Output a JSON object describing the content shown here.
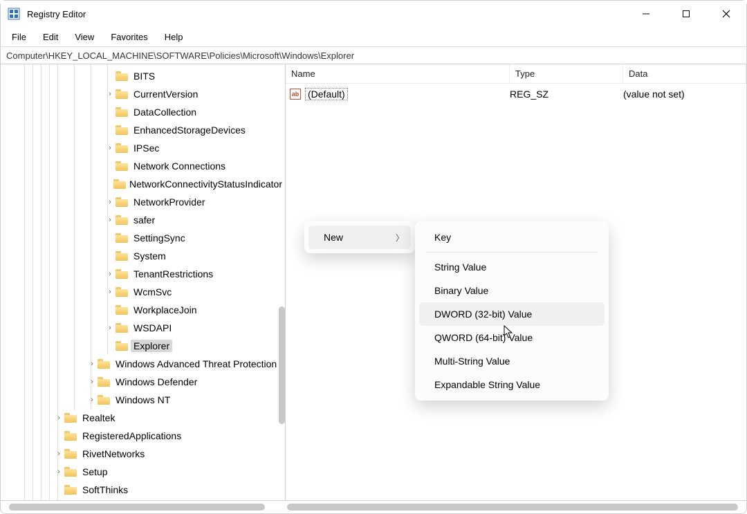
{
  "window": {
    "title": "Registry Editor"
  },
  "menu": {
    "items": [
      "File",
      "Edit",
      "View",
      "Favorites",
      "Help"
    ]
  },
  "address": {
    "path": "Computer\\HKEY_LOCAL_MACHINE\\SOFTWARE\\Policies\\Microsoft\\Windows\\Explorer"
  },
  "tree": {
    "items": [
      {
        "label": "BITS",
        "indent": 150,
        "expander": ""
      },
      {
        "label": "CurrentVersion",
        "indent": 150,
        "expander": "›"
      },
      {
        "label": "DataCollection",
        "indent": 150,
        "expander": ""
      },
      {
        "label": "EnhancedStorageDevices",
        "indent": 150,
        "expander": ""
      },
      {
        "label": "IPSec",
        "indent": 150,
        "expander": "›"
      },
      {
        "label": "Network Connections",
        "indent": 150,
        "expander": ""
      },
      {
        "label": "NetworkConnectivityStatusIndicator",
        "indent": 150,
        "expander": ""
      },
      {
        "label": "NetworkProvider",
        "indent": 150,
        "expander": "›"
      },
      {
        "label": "safer",
        "indent": 150,
        "expander": "›"
      },
      {
        "label": "SettingSync",
        "indent": 150,
        "expander": ""
      },
      {
        "label": "System",
        "indent": 150,
        "expander": ""
      },
      {
        "label": "TenantRestrictions",
        "indent": 150,
        "expander": "›"
      },
      {
        "label": "WcmSvc",
        "indent": 150,
        "expander": "›"
      },
      {
        "label": "WorkplaceJoin",
        "indent": 150,
        "expander": ""
      },
      {
        "label": "WSDAPI",
        "indent": 150,
        "expander": "›"
      },
      {
        "label": "Explorer",
        "indent": 150,
        "expander": "",
        "selected": true
      },
      {
        "label": "Windows Advanced Threat Protection",
        "indent": 124,
        "expander": "›"
      },
      {
        "label": "Windows Defender",
        "indent": 124,
        "expander": "›"
      },
      {
        "label": "Windows NT",
        "indent": 124,
        "expander": "›"
      },
      {
        "label": "Realtek",
        "indent": 76,
        "expander": "›"
      },
      {
        "label": "RegisteredApplications",
        "indent": 76,
        "expander": ""
      },
      {
        "label": "RivetNetworks",
        "indent": 76,
        "expander": "›"
      },
      {
        "label": "Setup",
        "indent": 76,
        "expander": "›"
      },
      {
        "label": "SoftThinks",
        "indent": 76,
        "expander": ""
      }
    ]
  },
  "list": {
    "headers": {
      "name": "Name",
      "type": "Type",
      "data": "Data"
    },
    "rows": [
      {
        "name": "(Default)",
        "type": "REG_SZ",
        "data": "(value not set)",
        "icon": "ab"
      }
    ]
  },
  "context_menu": {
    "parent": {
      "label": "New"
    },
    "submenu": [
      {
        "label": "Key",
        "sep_after": true
      },
      {
        "label": "String Value"
      },
      {
        "label": "Binary Value"
      },
      {
        "label": "DWORD (32-bit) Value",
        "hover": true
      },
      {
        "label": "QWORD (64-bit) Value"
      },
      {
        "label": "Multi-String Value"
      },
      {
        "label": "Expandable String Value"
      }
    ]
  }
}
